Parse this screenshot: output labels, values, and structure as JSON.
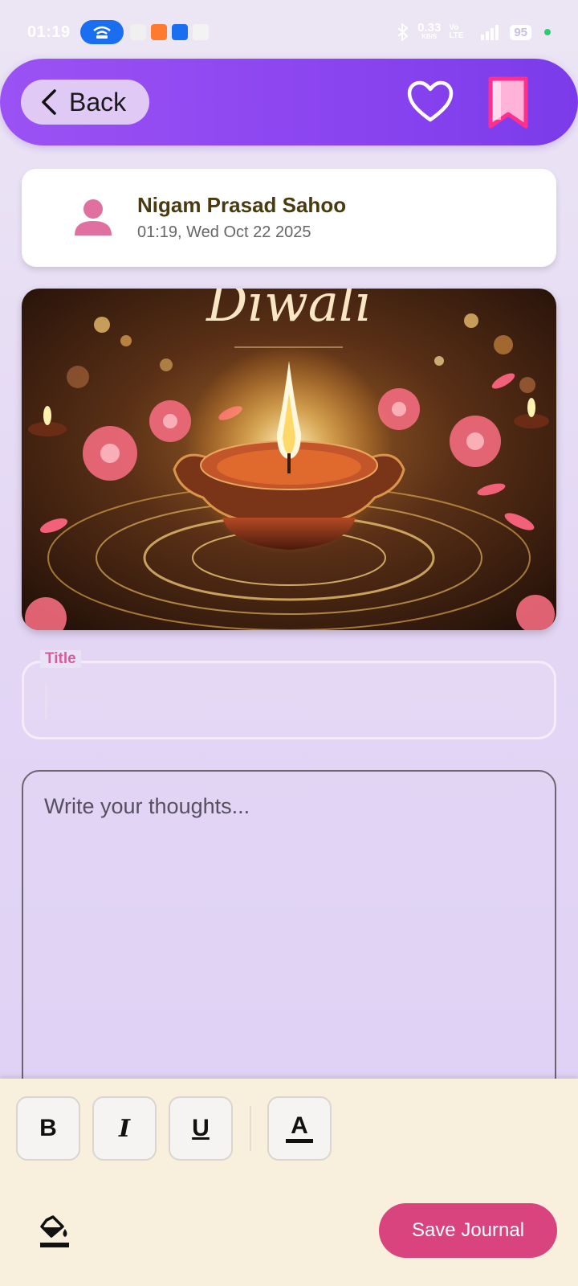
{
  "status_bar": {
    "time": "01:19",
    "net_speed": "0.33",
    "net_unit": "KB/S",
    "volte": "Vo LTE",
    "battery": "95"
  },
  "header": {
    "back_label": "Back"
  },
  "user": {
    "name": "Nigam Prasad Sahoo",
    "timestamp": "01:19, Wed Oct 22 2025"
  },
  "image": {
    "caption": "Diwali"
  },
  "form": {
    "title_label": "Title",
    "title_value": "",
    "thoughts_placeholder": "Write your thoughts..."
  },
  "toolbar": {
    "bold_label": "B",
    "italic_label": "I",
    "underline_label": "U",
    "text_color_label": "A",
    "save_label": "Save Journal"
  },
  "colors": {
    "header_gradient_start": "#9b52f4",
    "header_gradient_end": "#7b3bea",
    "accent_pink": "#d9437e",
    "toolbar_bg": "#f8f0dc"
  }
}
